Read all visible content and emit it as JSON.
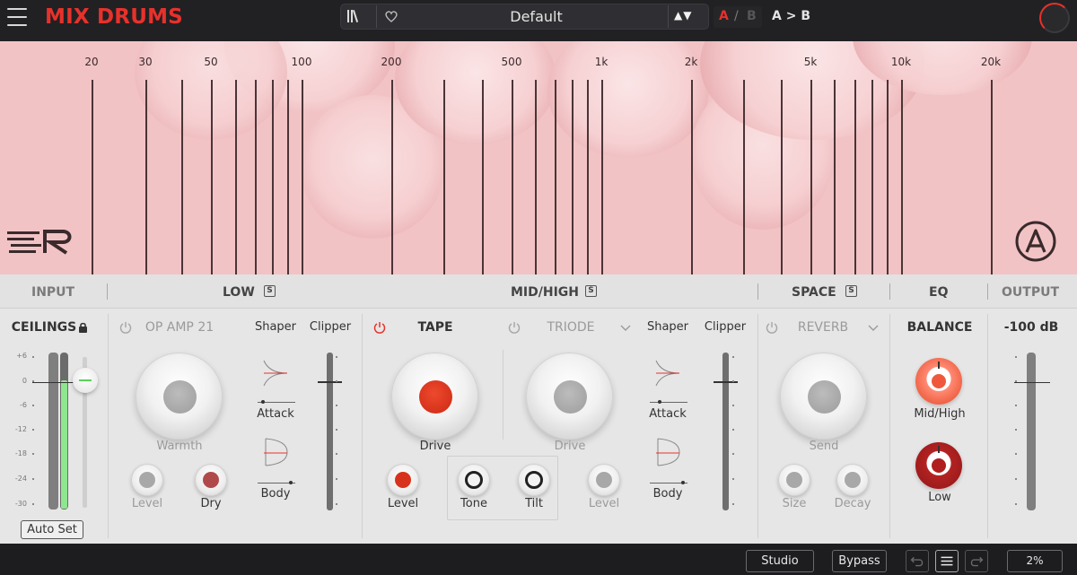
{
  "header": {
    "title": "MIX DRUMS",
    "preset_name": "Default",
    "preset_arrows": "▲▼",
    "ab_a": "A",
    "ab_slash": "/",
    "ab_b": "B",
    "ab_copy": "A > B",
    "icons": {
      "menu": "hamburger-icon",
      "library": "library-icon",
      "favorite": "heart-icon",
      "cpu": "cpu-knob"
    }
  },
  "spectrum": {
    "freq_labels": [
      "20",
      "30",
      "50",
      "100",
      "200",
      "500",
      "1k",
      "2k",
      "5k",
      "10k",
      "20k"
    ]
  },
  "sections": {
    "input": "INPUT",
    "low": "LOW",
    "midhigh": "MID/HIGH",
    "space": "SPACE",
    "eq": "EQ",
    "output": "OUTPUT",
    "solo": "S"
  },
  "input": {
    "ceilings_label": "CEILINGS",
    "scale": [
      "+6",
      "0",
      "-6",
      "-12",
      "-18",
      "-24",
      "-30"
    ],
    "meter_level": 0.82,
    "auto_set": "Auto Set"
  },
  "low": {
    "module": "OP AMP 21",
    "shaper": "Shaper",
    "clipper": "Clipper",
    "attack": "Attack",
    "body": "Body",
    "warmth": "Warmth",
    "level": "Level",
    "dry": "Dry"
  },
  "midhigh": {
    "tape": "TAPE",
    "drive": "Drive",
    "level": "Level",
    "tone": "Tone",
    "tilt": "Tilt",
    "triode": "TRIODE",
    "triode_drive": "Drive",
    "triode_level": "Level",
    "shaper": "Shaper",
    "clipper": "Clipper",
    "attack": "Attack",
    "body": "Body"
  },
  "space": {
    "reverb": "REVERB",
    "send": "Send",
    "size": "Size",
    "decay": "Decay"
  },
  "eq": {
    "balance": "BALANCE",
    "midhigh": "Mid/High",
    "low": "Low"
  },
  "output": {
    "level": "-100 dB"
  },
  "bottom": {
    "studio": "Studio",
    "bypass": "Bypass",
    "cpu": "2%"
  },
  "colors": {
    "accent": "#e8312b",
    "background_visual": "#f2c3c5",
    "meter_green": "#8ee68e"
  }
}
